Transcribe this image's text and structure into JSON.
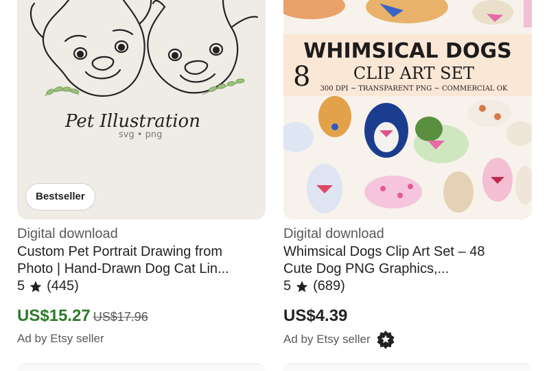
{
  "listings": [
    {
      "image": {
        "script_text": "Pet Illustration",
        "format_text": "svg • png"
      },
      "badge": "Bestseller",
      "type": "Digital download",
      "title_line1": "Custom Pet Portrait Drawing from",
      "title_line2": "Photo | Hand-Drawn Dog Cat Lin...",
      "rating": "5",
      "reviews": "(445)",
      "price": "US$15.27",
      "original_price": "US$17.96",
      "ad_text": "Ad by Etsy seller"
    },
    {
      "image": {
        "headline": "WHIMSICAL DOGS",
        "number": "8",
        "subheadline": "CLIP ART SET",
        "specs": "300 DPI ~ TRANSPARENT PNG ~ COMMERCIAL OK"
      },
      "type": "Digital download",
      "title_line1": "Whimsical Dogs Clip Art Set – 48",
      "title_line2": "Cute Dog PNG Graphics,...",
      "rating": "5",
      "reviews": "(689)",
      "price": "US$4.39",
      "ad_text": "Ad by Etsy seller",
      "star_seller_icon": "star-seller-icon"
    }
  ],
  "colors": {
    "sale_price": "#2f7a2a",
    "regular_price": "#222222",
    "muted_text": "#595959",
    "star_seller": "#222222"
  }
}
